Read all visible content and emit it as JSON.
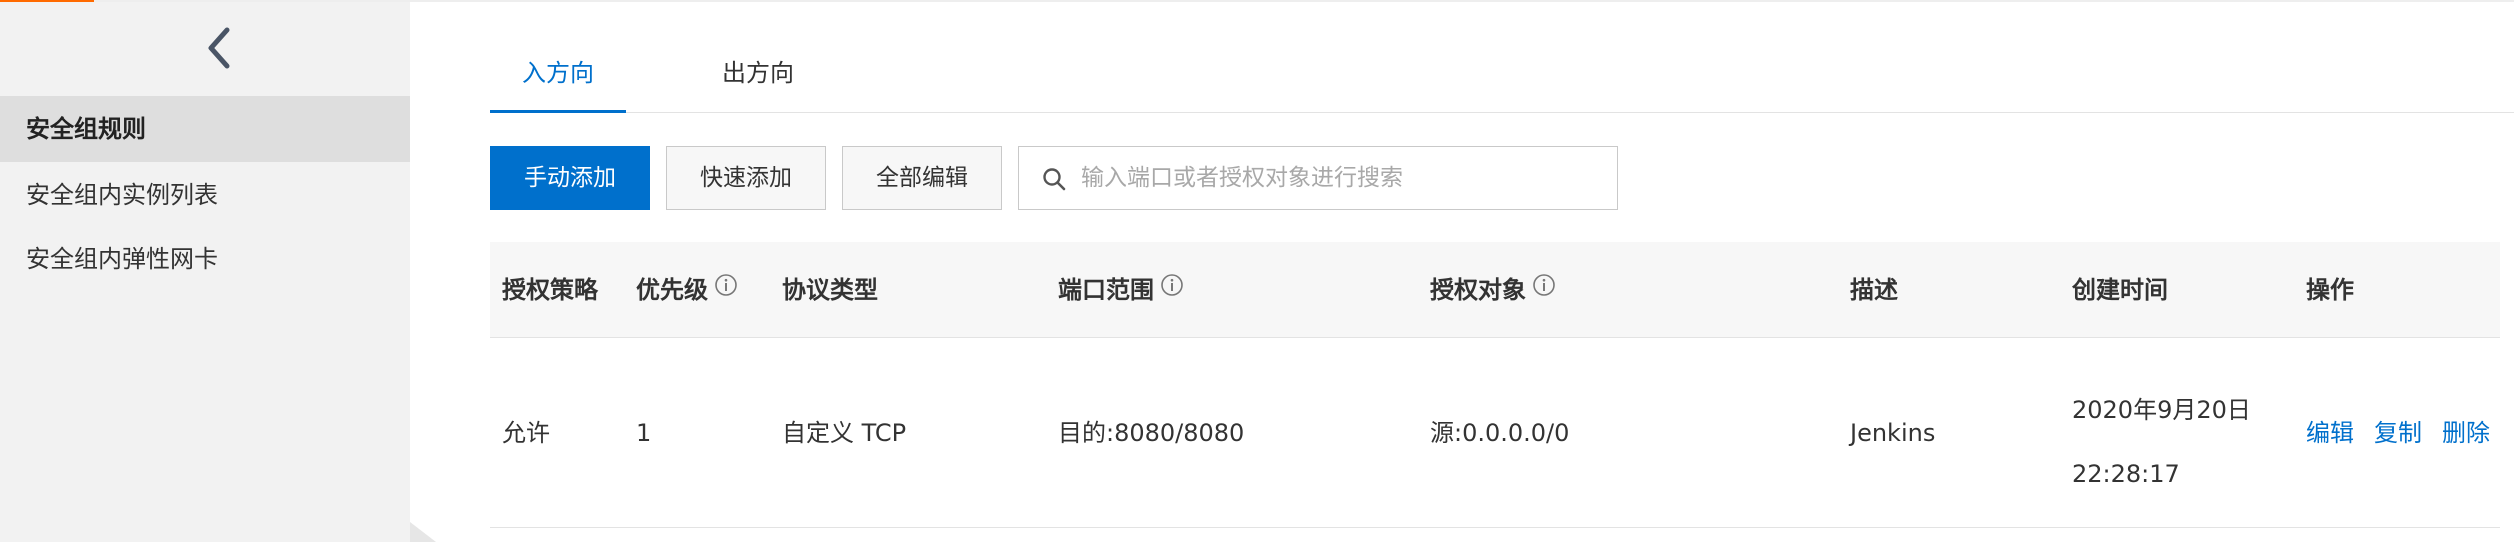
{
  "sidebar": {
    "items": [
      {
        "label": "安全组规则"
      },
      {
        "label": "安全组内实例列表"
      },
      {
        "label": "安全组内弹性网卡"
      }
    ]
  },
  "tabs": [
    {
      "label": "入方向"
    },
    {
      "label": "出方向"
    }
  ],
  "toolbar": {
    "manual_add": "手动添加",
    "quick_add": "快速添加",
    "edit_all": "全部编辑",
    "search_placeholder": "输入端口或者授权对象进行搜索",
    "search_value": ""
  },
  "table": {
    "columns": [
      "授权策略",
      "优先级",
      "协议类型",
      "端口范围",
      "授权对象",
      "描述",
      "创建时间",
      "操作"
    ],
    "rows": [
      {
        "policy": "允许",
        "priority": "1",
        "protocol": "自定义 TCP",
        "port_range": "目的:8080/8080",
        "source": "源:0.0.0.0/0",
        "description": "Jenkins",
        "created_date": "2020年9月20日",
        "created_time": "22:28:17",
        "actions": [
          "编辑",
          "复制",
          "删除"
        ]
      }
    ]
  },
  "colors": {
    "primary": "#0070cc",
    "accent": "#ff6a00",
    "sidebar_bg": "#f2f2f2",
    "sidebar_active": "#dedede"
  },
  "icons": [
    "chevron-left-icon",
    "search-icon",
    "info-icon"
  ]
}
